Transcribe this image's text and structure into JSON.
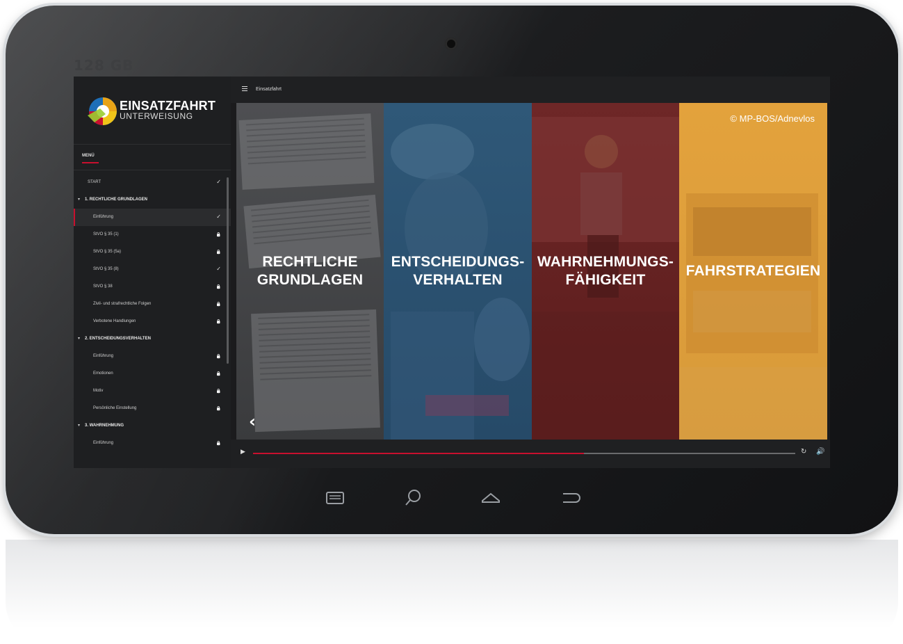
{
  "device": {
    "storage_label": "128 GB",
    "nav_buttons": [
      "menu-icon",
      "search-icon",
      "home-icon",
      "back-icon"
    ]
  },
  "app": {
    "brand_title": "EINSATZFAHRT",
    "brand_subtitle": "UNTERWEISUNG",
    "course_title": "Einsatzfahrt",
    "accent_color": "#c8102e"
  },
  "sidebar": {
    "menu_heading": "MENÜ",
    "items": [
      {
        "label": "START",
        "type": "top",
        "status": "check"
      },
      {
        "label": "1. RECHTLICHE GRUNDLAGEN",
        "type": "section",
        "status": ""
      },
      {
        "label": "Einführung",
        "type": "sub",
        "status": "check",
        "active": true
      },
      {
        "label": "StVO § 35 (1)",
        "type": "sub",
        "status": "lock"
      },
      {
        "label": "StVO § 35 (5a)",
        "type": "sub",
        "status": "lock"
      },
      {
        "label": "StVO § 35 (8)",
        "type": "sub",
        "status": "check"
      },
      {
        "label": "StVO § 38",
        "type": "sub",
        "status": "lock"
      },
      {
        "label": "Zivil- und strafrechtliche Folgen",
        "type": "sub",
        "status": "lock"
      },
      {
        "label": "Verbotene Handlungen",
        "type": "sub",
        "status": "lock"
      },
      {
        "label": "2. ENTSCHEIDUNGSVERHALTEN",
        "type": "section",
        "status": ""
      },
      {
        "label": "Einführung",
        "type": "sub",
        "status": "lock"
      },
      {
        "label": "Emotionen",
        "type": "sub",
        "status": "lock"
      },
      {
        "label": "Motiv",
        "type": "sub",
        "status": "lock"
      },
      {
        "label": "Persönliche Einstellung",
        "type": "sub",
        "status": "lock"
      },
      {
        "label": "3. WAHRNEHMUNG",
        "type": "section",
        "status": ""
      },
      {
        "label": "Einführung",
        "type": "sub",
        "status": "lock"
      }
    ]
  },
  "panels": [
    {
      "line1": "RECHTLICHE",
      "line2": "GRUNDLAGEN",
      "color": "#4a4b4e"
    },
    {
      "line1": "ENTSCHEIDUNGS-",
      "line2": "VERHALTEN",
      "color": "#2c5576"
    },
    {
      "line1": "WAHRNEHMUNGS-",
      "line2": "FÄHIGKEIT",
      "color": "#652222"
    },
    {
      "line1": "FAHRSTRATEGIEN",
      "line2": "",
      "color": "#e09f3c"
    }
  ],
  "copyright": "© MP-BOS/Adnevlos",
  "player": {
    "progress": 0.61
  }
}
